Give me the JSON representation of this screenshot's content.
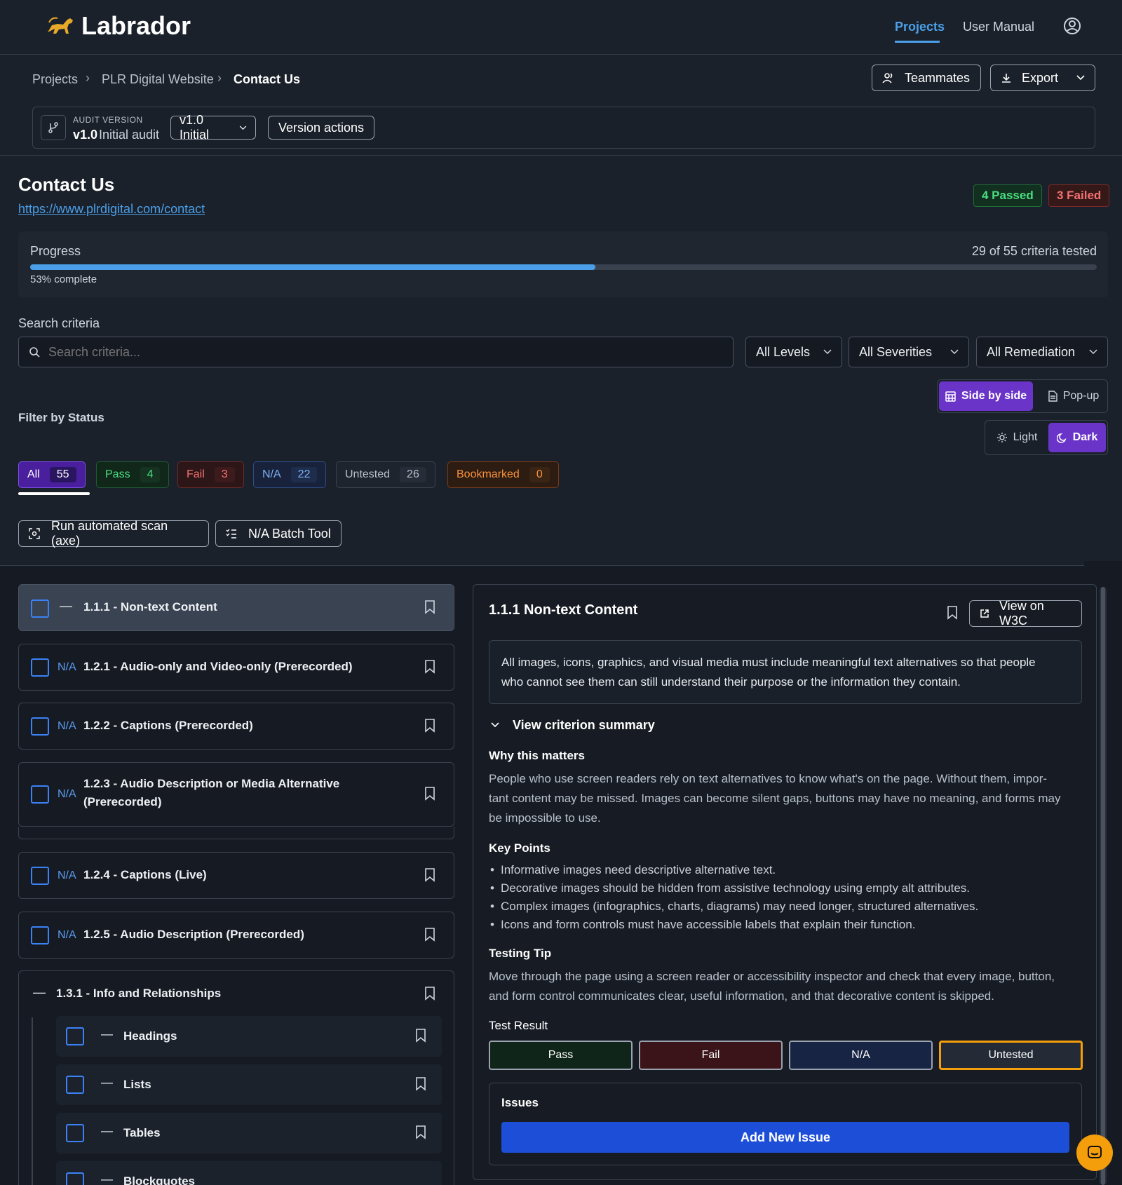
{
  "app": {
    "name": "Labrador"
  },
  "nav": {
    "projects": "Projects",
    "manual": "User Manual"
  },
  "breadcrumb": {
    "projects": "Projects",
    "site": "PLR Digital Website",
    "page": "Contact Us"
  },
  "actions": {
    "teammates": "Teammates",
    "export": "Export"
  },
  "audit": {
    "label": "AUDIT VERSION",
    "version": "v1.0",
    "name": "Initial audit",
    "select": "v1.0 Initial",
    "actions": "Version actions"
  },
  "page": {
    "title": "Contact Us",
    "url": "https://www.plrdigital.com/contact",
    "passed": "4 Passed",
    "failed": "3 Failed"
  },
  "progress": {
    "label": "Progress",
    "tested": "29 of 55 criteria tested",
    "complete": "53% complete",
    "fraction": 0.53
  },
  "search": {
    "label": "Search criteria",
    "placeholder": "Search criteria..."
  },
  "filters": {
    "levels": "All Levels",
    "severities": "All Severities",
    "remediation": "All Remediation"
  },
  "view": {
    "side": "Side by side",
    "popup": "Pop-up",
    "light": "Light",
    "dark": "Dark"
  },
  "status_filter": {
    "label": "Filter by Status",
    "all": {
      "label": "All",
      "count": "55"
    },
    "pass": {
      "label": "Pass",
      "count": "4"
    },
    "fail": {
      "label": "Fail",
      "count": "3"
    },
    "na": {
      "label": "N/A",
      "count": "22"
    },
    "untested": {
      "label": "Untested",
      "count": "26"
    },
    "bookmarked": {
      "label": "Bookmarked",
      "count": "0"
    }
  },
  "tools": {
    "scan": "Run automated scan (axe)",
    "batch": "N/A Batch Tool"
  },
  "criteria": {
    "dash": "—",
    "na": "N/A",
    "c111": "1.1.1 - Non-text Content",
    "c121": "1.2.1 - Audio-only and Video-only (Prerecorded)",
    "c122": "1.2.2 - Captions (Prerecorded)",
    "c123a": "1.2.3 - Audio Description or Media Alternative",
    "c123b": "(Prerecorded)",
    "c124": "1.2.4 - Captions (Live)",
    "c125": "1.2.5 - Audio Description (Prerecorded)",
    "c131": "1.3.1 - Info and Relationships",
    "headings": "Headings",
    "lists": "Lists",
    "tables": "Tables",
    "blockquotes": "Blockquotes"
  },
  "detail": {
    "title": "1.1.1 Non-text Content",
    "w3c": "View on W3C",
    "desc1": "All images, icons, graphics, and visual media must include meaningful text alternatives so that people",
    "desc2": "who cannot see them can still understand their purpose or the information they contain.",
    "summary": "View criterion summary",
    "why_title": "Why this matters",
    "why1": "People who use screen readers rely on text alternatives to know what's on the page. Without them, impor-",
    "why2": "tant content may be missed. Images can become silent gaps, buttons may have no meaning, and forms may",
    "why3": "be impossible to use.",
    "kp_title": "Key Points",
    "kp1": "Informative images need descriptive alternative text.",
    "kp2": "Decorative images should be hidden from assistive technology using empty alt attributes.",
    "kp3": "Complex images (infographics, charts, diagrams) may need longer, structured alternatives.",
    "kp4": "Icons and form controls must have accessible labels that explain their function.",
    "tip_title": "Testing Tip",
    "tip1": "Move through the page using a screen reader or accessibility inspector and check that every image, button,",
    "tip2": "and form control communicates clear, useful information, and that decorative content is skipped.",
    "result_title": "Test Result",
    "pass": "Pass",
    "fail": "Fail",
    "na": "N/A",
    "untested": "Untested",
    "issues": "Issues",
    "add_issue": "Add New Issue"
  },
  "colors": {
    "accent": "#4a9fe8",
    "purple": "#6b34c9",
    "progress": "#4a9fe8",
    "add_issue": "#1d4ed8",
    "untested_border": "#f59e0b"
  }
}
